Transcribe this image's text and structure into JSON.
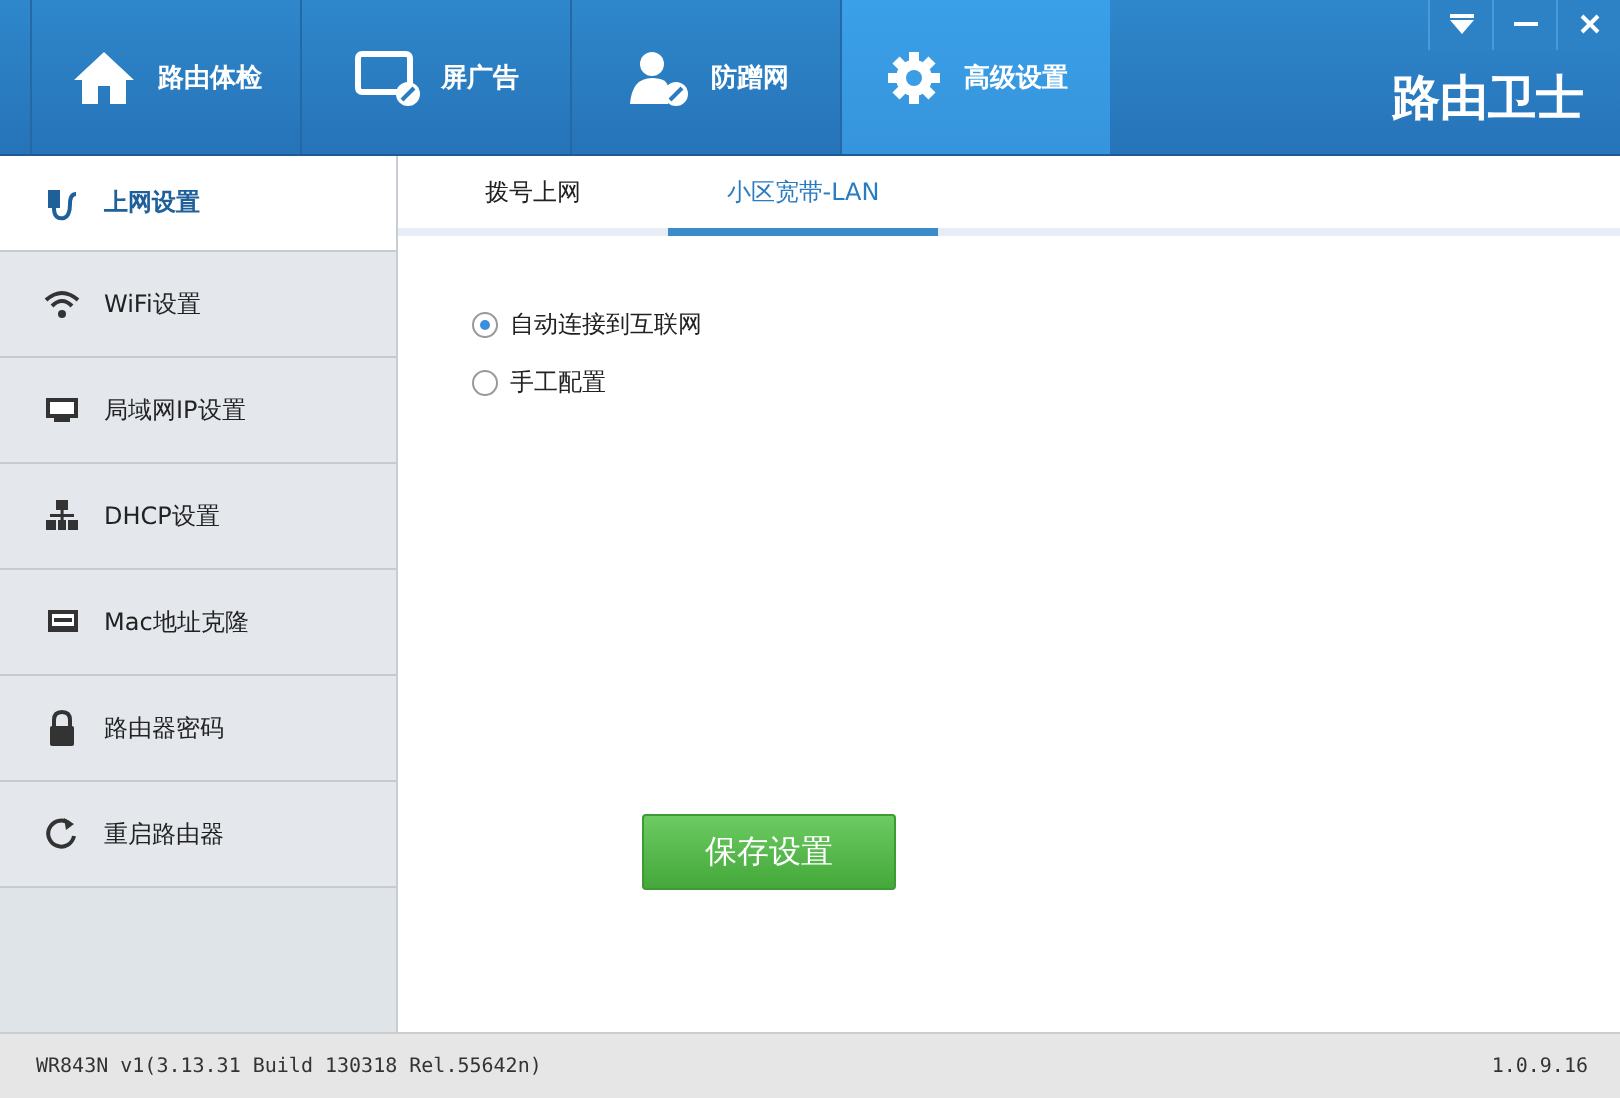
{
  "window": {
    "logo": "路由卫士"
  },
  "top_tabs": [
    {
      "label": "路由体检",
      "selected": false
    },
    {
      "label": "屏广告",
      "selected": false
    },
    {
      "label": "防蹭网",
      "selected": false
    },
    {
      "label": "高级设置",
      "selected": true
    }
  ],
  "sidebar": {
    "items": [
      {
        "label": "上网设置",
        "selected": true
      },
      {
        "label": "WiFi设置",
        "selected": false
      },
      {
        "label": "局域网IP设置",
        "selected": false
      },
      {
        "label": "DHCP设置",
        "selected": false
      },
      {
        "label": "Mac地址克隆",
        "selected": false
      },
      {
        "label": "路由器密码",
        "selected": false
      },
      {
        "label": "重启路由器",
        "selected": false
      }
    ]
  },
  "sub_tabs": [
    {
      "label": "拨号上网",
      "selected": false
    },
    {
      "label": "小区宽带-LAN",
      "selected": true
    }
  ],
  "options": [
    {
      "label": "自动连接到互联网",
      "selected": true
    },
    {
      "label": "手工配置",
      "selected": false
    }
  ],
  "save_button": "保存设置",
  "status_bar": {
    "version": "WR843N v1(3.13.31 Build 130318 Rel.55642n)",
    "app_version": "1.0.9.16"
  }
}
